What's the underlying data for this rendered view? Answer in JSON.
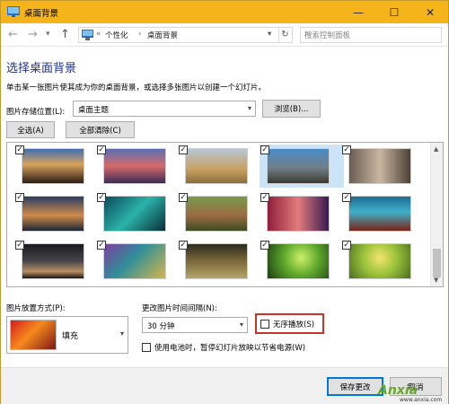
{
  "window": {
    "title": "桌面背景",
    "minimize_glyph": "—",
    "maximize_glyph": "☐",
    "close_glyph": "✕",
    "titlebar_color": "#f4b41a"
  },
  "nav": {
    "back_glyph": "←",
    "forward_glyph": "→",
    "recent_glyph": "▾",
    "up_glyph": "↑",
    "chevron_glyph": "«",
    "crumb1": "个性化",
    "separator_glyph": "›",
    "crumb2": "桌面背景",
    "dropdown_glyph": "▾",
    "refresh_glyph": "↻",
    "search_placeholder": "搜索控制面板",
    "search_glyph": "⌕"
  },
  "main": {
    "heading": "选择桌面背景",
    "description": "单击某一张图片使其成为你的桌面背景，或选择多张图片以创建一个幻灯片。",
    "location_label": "图片存储位置(L):",
    "location_value": "桌面主题",
    "browse_label": "浏览(B)...",
    "select_all_label": "全选(A)",
    "clear_all_label": "全部清除(C)",
    "heading_color": "#1e3287"
  },
  "gallery": {
    "checked_glyph": "✓",
    "scroll_up_glyph": "▲",
    "scroll_down_glyph": "▼",
    "images": [
      {
        "checked": true,
        "selected": false,
        "bg": "linear-gradient(180deg,#3f6fb3 0%,#d9a25c 45%,#2b1c14 100%)"
      },
      {
        "checked": true,
        "selected": false,
        "bg": "linear-gradient(180deg,#5a6fb4 0%,#d66a6a 50%,#3c2b57 100%)"
      },
      {
        "checked": true,
        "selected": false,
        "bg": "linear-gradient(180deg,#b8c7d6 0%,#c7a060 60%,#8a6d3a 100%)"
      },
      {
        "checked": true,
        "selected": true,
        "bg": "linear-gradient(180deg,#4a8cc9 0%,#6f7f86 55%,#3b3a31 100%)"
      },
      {
        "checked": true,
        "selected": false,
        "bg": "linear-gradient(90deg,#6a5e52 0%,#c9b6a0 50%,#4c4238 100%)"
      },
      {
        "checked": true,
        "selected": false,
        "bg": "linear-gradient(180deg,#2a3e63 0%,#d08a4a 55%,#1c2639 100%)"
      },
      {
        "checked": true,
        "selected": false,
        "bg": "linear-gradient(135deg,#0c4a5c 0%,#2ab3a9 50%,#0a2d38 100%)"
      },
      {
        "checked": true,
        "selected": false,
        "bg": "linear-gradient(180deg,#7a9a4b 0%,#9b6b43 55%,#3d4d22 100%)"
      },
      {
        "checked": true,
        "selected": false,
        "bg": "linear-gradient(90deg,#8f1f3a 0%,#e27b7b 50%,#3a1a52 100%)"
      },
      {
        "checked": true,
        "selected": false,
        "bg": "linear-gradient(180deg,#1c6b92 0%,#3fb0c9 45%,#7a2317 100%)"
      },
      {
        "checked": true,
        "selected": false,
        "bg": "linear-gradient(180deg,#1b1b1f 0%,#47454a 50%,#b88f63 80%,#1a1412 100%)"
      },
      {
        "checked": true,
        "selected": false,
        "bg": "linear-gradient(135deg,#7f3fa0 0%,#2f8f9a 45%,#d7b54a 100%)"
      },
      {
        "checked": true,
        "selected": false,
        "bg": "linear-gradient(180deg,#2c2a1d 0%,#7c6a3c 50%,#b5a36a 100%)"
      },
      {
        "checked": true,
        "selected": false,
        "bg": "radial-gradient(circle at 55% 40%,#cdf06e 0%,#5ea82b 45%,#1c3d12 100%)"
      },
      {
        "checked": true,
        "selected": false,
        "bg": "radial-gradient(circle at 50% 40%,#f2e66d 0%,#9cc33b 45%,#4c6f20 100%)"
      }
    ]
  },
  "position": {
    "label": "图片放置方式(P):",
    "value": "填充",
    "dropdown_glyph": "▾"
  },
  "interval": {
    "label": "更改图片时间间隔(N):",
    "value": "30 分钟",
    "dropdown_glyph": "▾"
  },
  "options": {
    "shuffle_label": "无序播放(S)",
    "shuffle_checked": false,
    "battery_label": "使用电池时，暂停幻灯片放映以节省电源(W)",
    "battery_checked": false,
    "highlight_color": "#c9332b"
  },
  "footer": {
    "save_label": "保存更改",
    "cancel_label": "取消"
  },
  "watermark": {
    "brand": "Anxia",
    "url": "www.anxia.com"
  }
}
